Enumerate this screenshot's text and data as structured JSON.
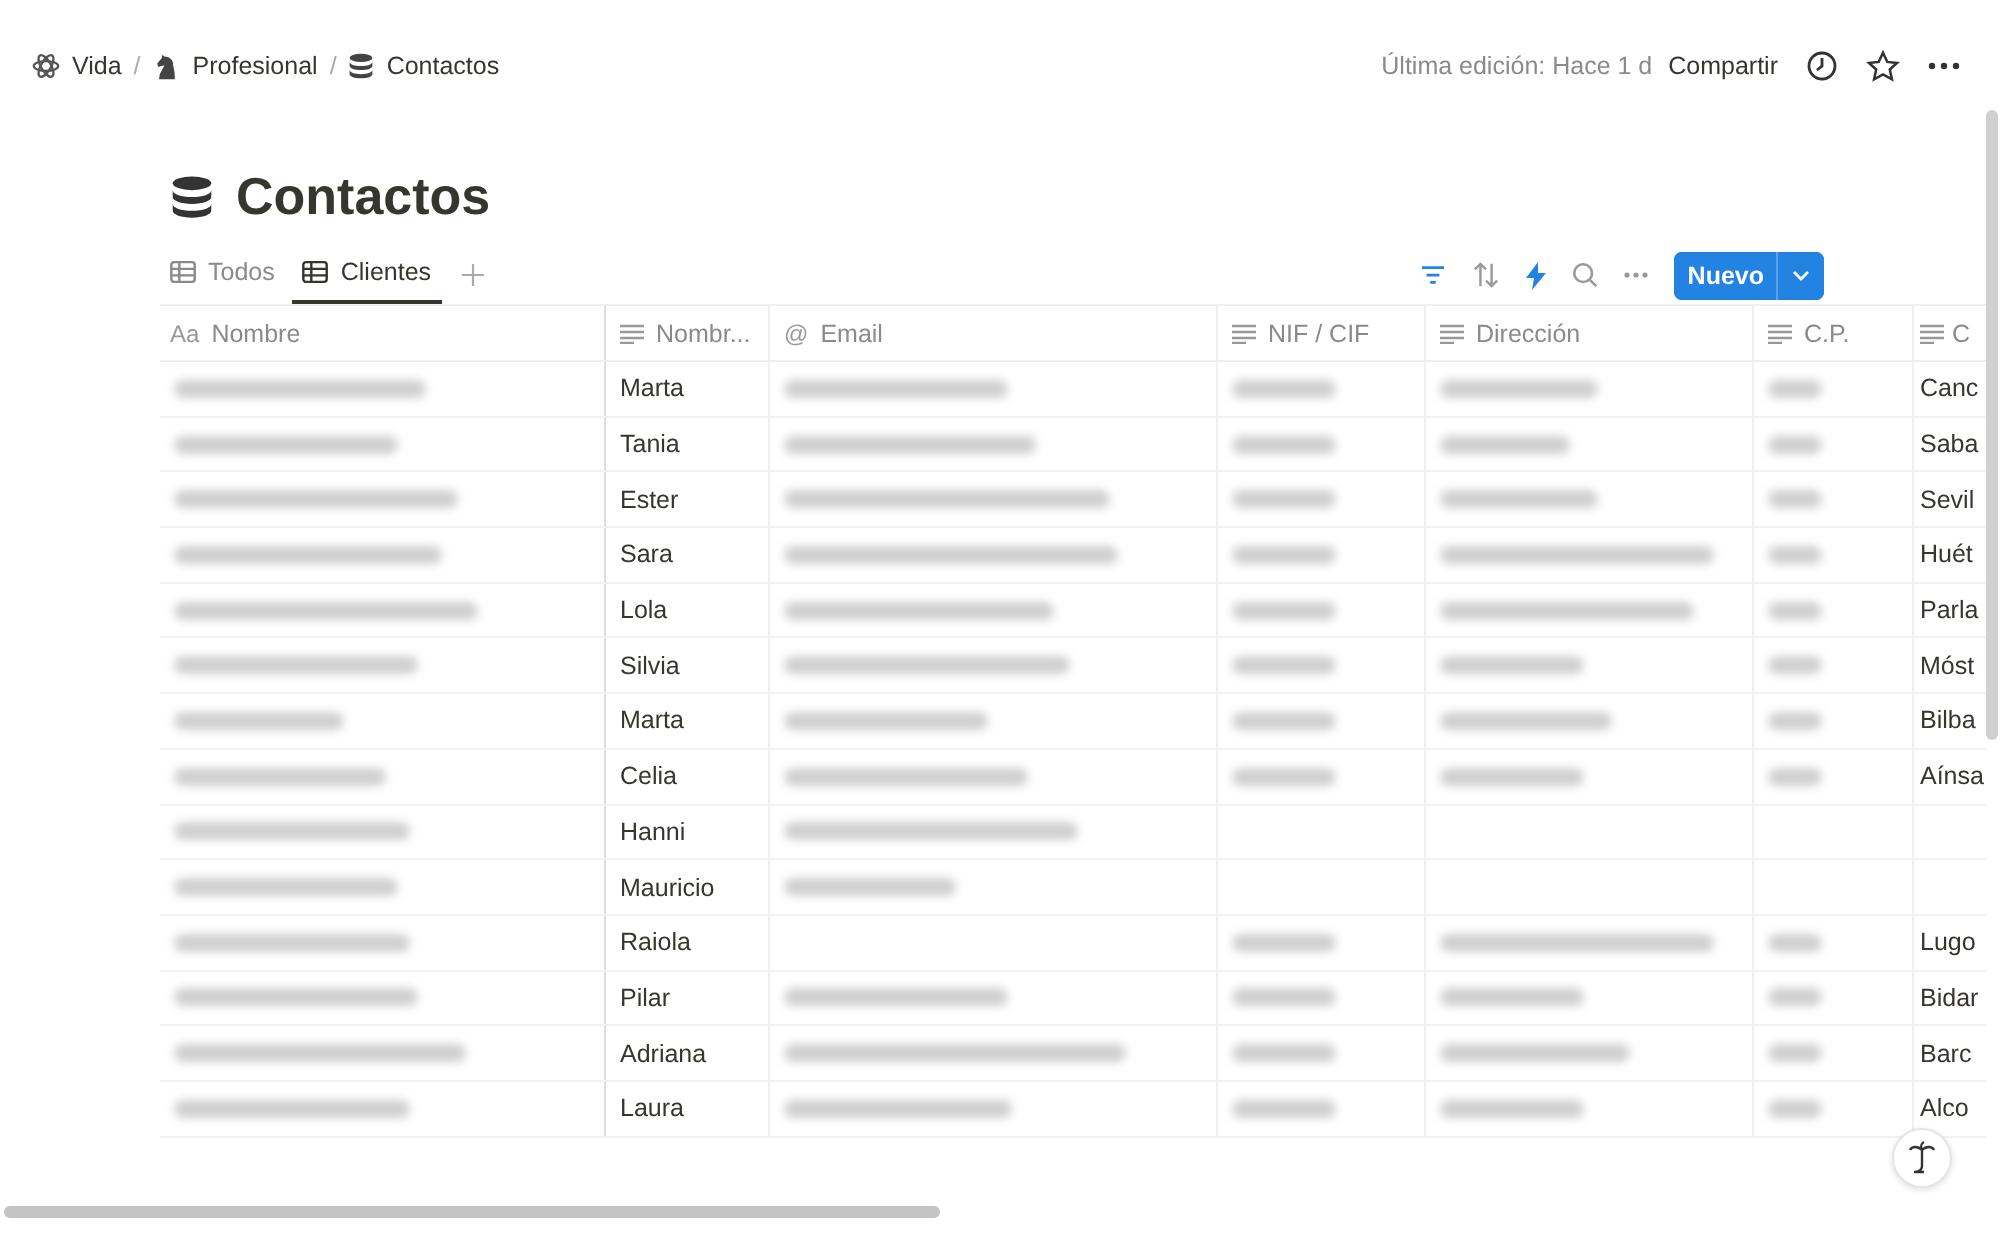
{
  "breadcrumbs": [
    {
      "label": "Vida"
    },
    {
      "label": "Profesional"
    },
    {
      "label": "Contactos"
    }
  ],
  "breadcrumb_separators": [
    "/",
    "/"
  ],
  "topbar": {
    "edited": "Última edición: Hace 1 d",
    "share": "Compartir"
  },
  "page": {
    "title": "Contactos"
  },
  "tabs": [
    {
      "label": "Todos",
      "selected": false
    },
    {
      "label": "Clientes",
      "selected": true
    }
  ],
  "toolbar": {
    "new_button": "Nuevo"
  },
  "table": {
    "columns": [
      {
        "label": "Nombre",
        "type_mark": "Aa",
        "kind": "title"
      },
      {
        "label": "Nombr...",
        "kind": "text"
      },
      {
        "label": "Email",
        "type_mark": "@",
        "kind": "email"
      },
      {
        "label": "NIF / CIF",
        "kind": "text"
      },
      {
        "label": "Dirección",
        "kind": "text"
      },
      {
        "label": "C.P.",
        "kind": "text"
      },
      {
        "label": "C",
        "kind": "text"
      }
    ],
    "rows": [
      {
        "first_name": "Marta",
        "city": "Canc",
        "blurred": {
          "name": true,
          "email": true,
          "nif": true,
          "address": true,
          "postcode": true
        }
      },
      {
        "first_name": "Tania",
        "city": "Saba",
        "blurred": {
          "name": true,
          "email": true,
          "nif": true,
          "address": true,
          "postcode": true
        }
      },
      {
        "first_name": "Ester",
        "city": "Sevil",
        "blurred": {
          "name": true,
          "email": true,
          "nif": true,
          "address": true,
          "postcode": true
        }
      },
      {
        "first_name": "Sara",
        "city": "Huét",
        "blurred": {
          "name": true,
          "email": true,
          "nif": true,
          "address": true,
          "postcode": true
        }
      },
      {
        "first_name": "Lola",
        "city": "Parla",
        "blurred": {
          "name": true,
          "email": true,
          "nif": true,
          "address": true,
          "postcode": true
        }
      },
      {
        "first_name": "Silvia",
        "city": "Móst",
        "blurred": {
          "name": true,
          "email": true,
          "nif": true,
          "address": true,
          "postcode": true
        }
      },
      {
        "first_name": "Marta",
        "city": "Bilba",
        "blurred": {
          "name": true,
          "email": true,
          "nif": true,
          "address": true,
          "postcode": true
        }
      },
      {
        "first_name": "Celia",
        "city": "Aínsa",
        "blurred": {
          "name": true,
          "email": true,
          "nif": true,
          "address": true,
          "postcode": true
        }
      },
      {
        "first_name": "Hanni",
        "blurred": {
          "name": true,
          "email": true,
          "nif": false,
          "address": false,
          "postcode": false
        }
      },
      {
        "first_name": "Mauricio",
        "blurred": {
          "name": true,
          "email": true,
          "nif": false,
          "address": false,
          "postcode": false
        }
      },
      {
        "first_name": "Raiola",
        "city": "Lugo",
        "blurred": {
          "name": true,
          "email": false,
          "nif": true,
          "address": true,
          "postcode": true
        }
      },
      {
        "first_name": "Pilar",
        "city": "Bidar",
        "blurred": {
          "name": true,
          "email": true,
          "nif": true,
          "address": true,
          "postcode": true
        }
      },
      {
        "first_name": "Adriana",
        "city": "Barc",
        "blurred": {
          "name": true,
          "email": true,
          "nif": true,
          "address": true,
          "postcode": true
        }
      },
      {
        "first_name": "Laura",
        "city": "Alco",
        "blurred": {
          "name": true,
          "email": true,
          "nif": true,
          "address": true,
          "postcode": true
        }
      }
    ]
  }
}
